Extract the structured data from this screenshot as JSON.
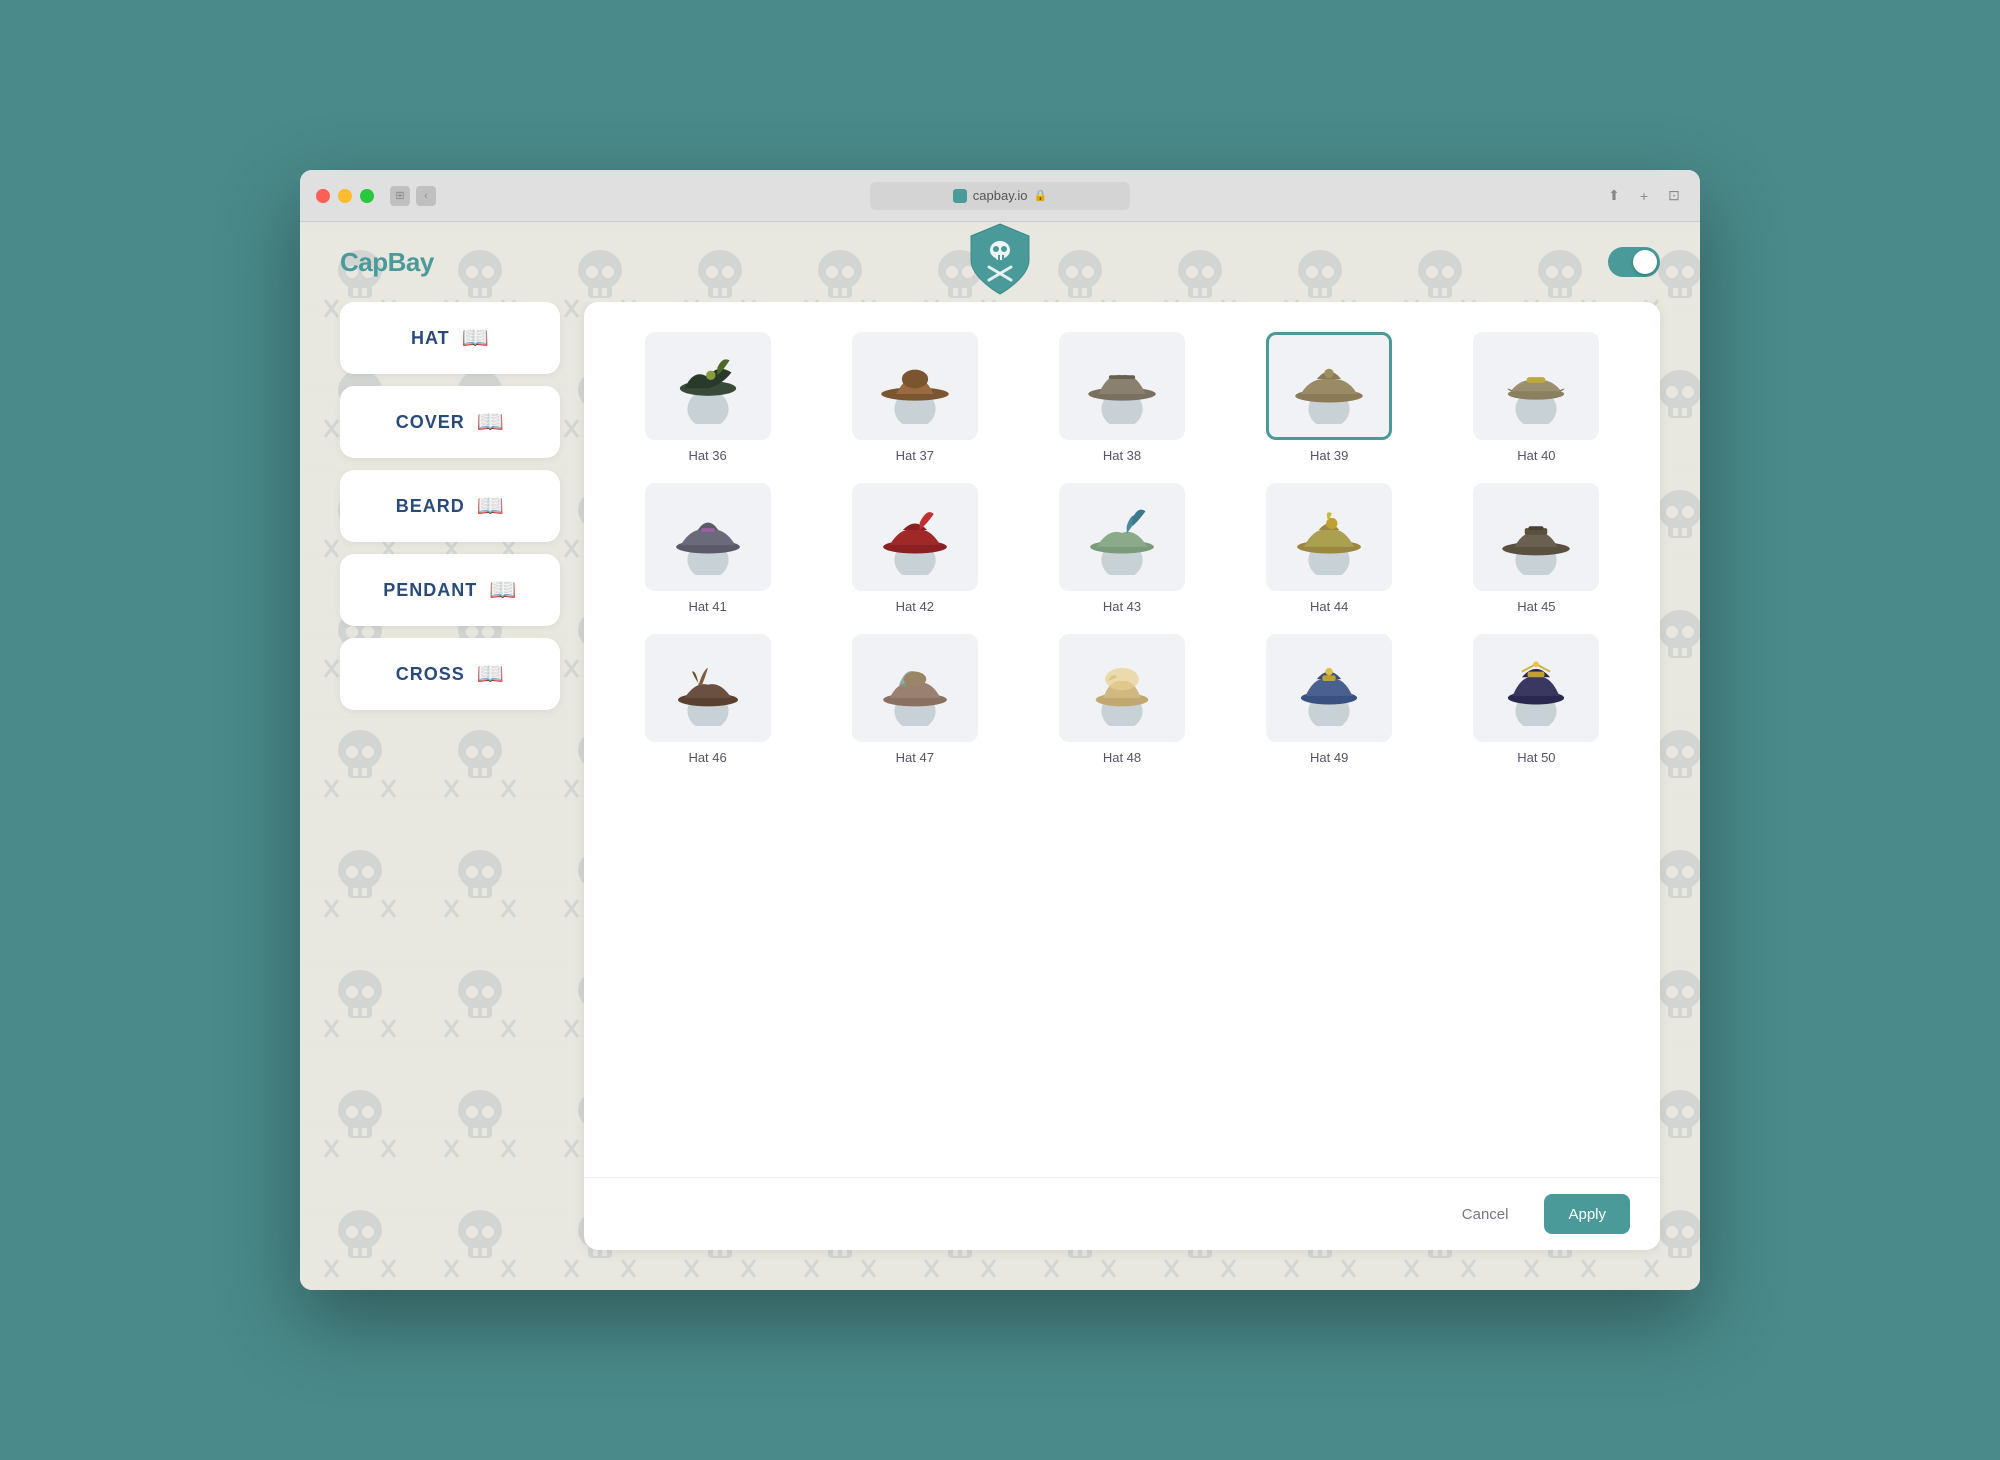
{
  "app": {
    "title": "CapBay",
    "url": "capbay.io"
  },
  "toggle": {
    "enabled": true
  },
  "sidebar": {
    "items": [
      {
        "id": "hat",
        "label": "HAT",
        "icon": "book-icon"
      },
      {
        "id": "cover",
        "label": "COVER",
        "icon": "book-icon"
      },
      {
        "id": "beard",
        "label": "BEARD",
        "icon": "book-icon"
      },
      {
        "id": "pendant",
        "label": "PENDANT",
        "icon": "book-icon"
      },
      {
        "id": "cross",
        "label": "CROSS",
        "icon": "book-icon"
      }
    ]
  },
  "grid": {
    "selected_id": 39,
    "items": [
      {
        "id": 36,
        "label": "Hat 36",
        "color": "#3a5a4a",
        "style": "feathered-dark"
      },
      {
        "id": 37,
        "label": "Hat 37",
        "color": "#7a5530",
        "style": "wide-brown"
      },
      {
        "id": 38,
        "label": "Hat 38",
        "color": "#6a6050",
        "style": "flat-grey"
      },
      {
        "id": 39,
        "label": "Hat 39",
        "color": "#8a7a55",
        "style": "tricorn-tan",
        "selected": true
      },
      {
        "id": 40,
        "label": "Hat 40",
        "color": "#8a8060",
        "style": "bicorn-gold"
      },
      {
        "id": 41,
        "label": "Hat 41",
        "color": "#5a5a6a",
        "style": "tricorn-purple"
      },
      {
        "id": 42,
        "label": "Hat 42",
        "color": "#8a2020",
        "style": "feathered-red"
      },
      {
        "id": 43,
        "label": "Hat 43",
        "color": "#7a9a7a",
        "style": "feathered-teal"
      },
      {
        "id": 44,
        "label": "Hat 44",
        "color": "#9a8840",
        "style": "feathered-gold"
      },
      {
        "id": 45,
        "label": "Hat 45",
        "color": "#5a5040",
        "style": "flat-dark"
      },
      {
        "id": 46,
        "label": "Hat 46",
        "color": "#5a4030",
        "style": "horn-dark"
      },
      {
        "id": 47,
        "label": "Hat 47",
        "color": "#8a7060",
        "style": "fancy-beige"
      },
      {
        "id": 48,
        "label": "Hat 48",
        "color": "#c0a870",
        "style": "fluffy-gold"
      },
      {
        "id": 49,
        "label": "Hat 49",
        "color": "#3a5080",
        "style": "captain-blue"
      },
      {
        "id": 50,
        "label": "Hat 50",
        "color": "#2a2850",
        "style": "navy-admiral"
      }
    ]
  },
  "actions": {
    "cancel_label": "Cancel",
    "apply_label": "Apply"
  },
  "colors": {
    "teal": "#4a9a9a",
    "selected_border": "#4a9a9a",
    "bg": "#4a8a8a"
  }
}
